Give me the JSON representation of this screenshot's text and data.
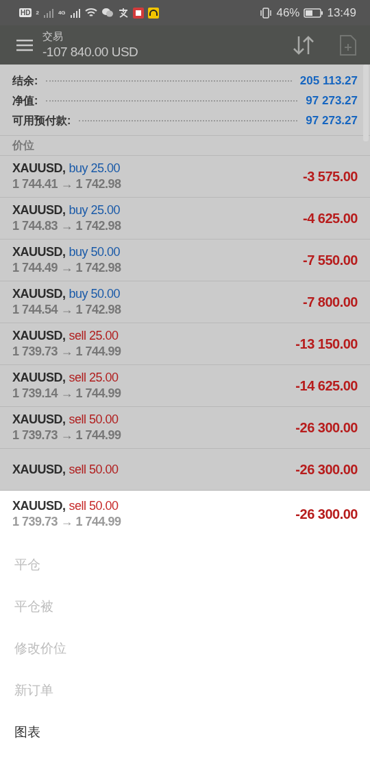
{
  "status_bar": {
    "hd": "HD",
    "sim": "2",
    "network": "4G",
    "battery_percent": "46%",
    "time": "13:49"
  },
  "header": {
    "title": "交易",
    "balance": "-107 840.00 USD"
  },
  "summary": [
    {
      "label": "结余:",
      "value": "205 113.27"
    },
    {
      "label": "净值:",
      "value": "97 273.27"
    },
    {
      "label": "可用预付款:",
      "value": "97 273.27"
    }
  ],
  "section_title": "价位",
  "positions": [
    {
      "symbol": "XAUUSD,",
      "type": "buy",
      "volume": "25.00",
      "prices": "1 744.41 → 1 742.98",
      "profit": "-3 575.00"
    },
    {
      "symbol": "XAUUSD,",
      "type": "buy",
      "volume": "25.00",
      "prices": "1 744.83 → 1 742.98",
      "profit": "-4 625.00"
    },
    {
      "symbol": "XAUUSD,",
      "type": "buy",
      "volume": "50.00",
      "prices": "1 744.49 → 1 742.98",
      "profit": "-7 550.00"
    },
    {
      "symbol": "XAUUSD,",
      "type": "buy",
      "volume": "50.00",
      "prices": "1 744.54 → 1 742.98",
      "profit": "-7 800.00"
    },
    {
      "symbol": "XAUUSD,",
      "type": "sell",
      "volume": "25.00",
      "prices": "1 739.73 → 1 744.99",
      "profit": "-13 150.00"
    },
    {
      "symbol": "XAUUSD,",
      "type": "sell",
      "volume": "25.00",
      "prices": "1 739.14 → 1 744.99",
      "profit": "-14 625.00"
    },
    {
      "symbol": "XAUUSD,",
      "type": "sell",
      "volume": "50.00",
      "prices": "1 739.73 → 1 744.99",
      "profit": "-26 300.00"
    },
    {
      "symbol": "XAUUSD,",
      "type": "sell",
      "volume": "50.00",
      "profit": "-26 300.00"
    }
  ],
  "sheet": {
    "position": {
      "symbol": "XAUUSD,",
      "type": "sell",
      "volume": "50.00",
      "prices": "1 739.73 → 1 744.99",
      "profit": "-26 300.00"
    },
    "actions": [
      {
        "label": "平仓",
        "disabled": true
      },
      {
        "label": "平仓被",
        "disabled": true
      },
      {
        "label": "修改价位",
        "disabled": true
      },
      {
        "label": "新订单",
        "disabled": true
      },
      {
        "label": "图表",
        "disabled": false
      }
    ]
  }
}
